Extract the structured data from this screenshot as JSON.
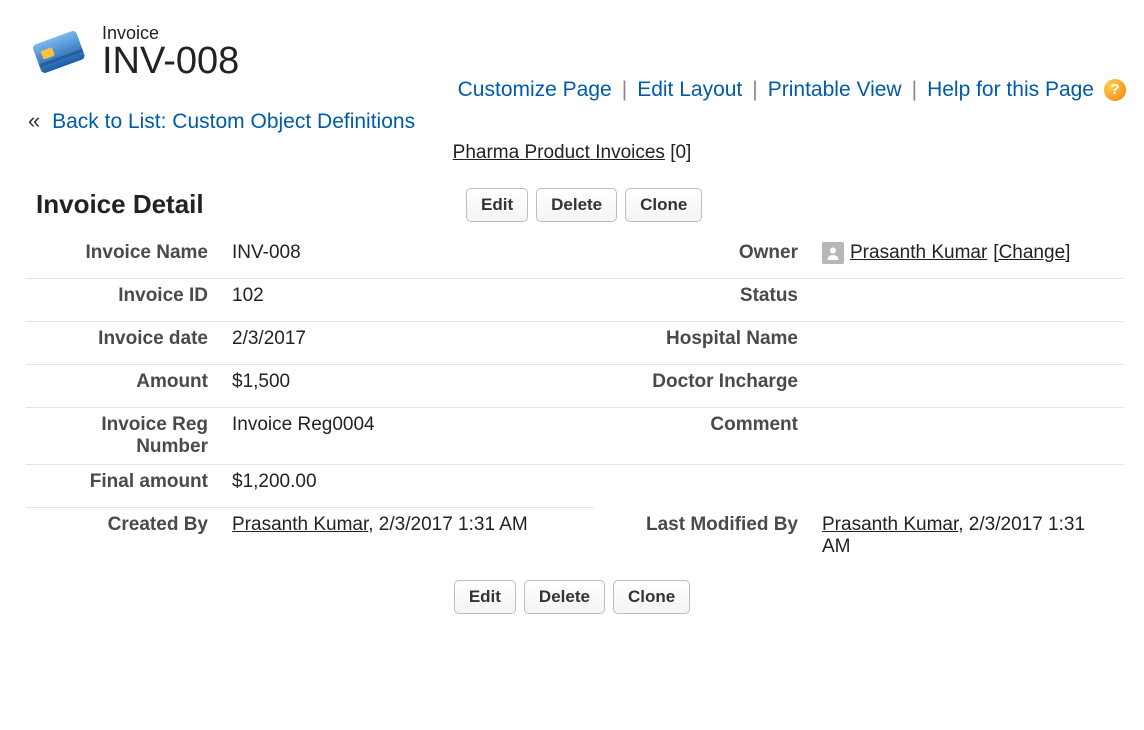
{
  "header": {
    "object_label": "Invoice",
    "record_name": "INV-008"
  },
  "action_links": {
    "customize": "Customize Page",
    "edit_layout": "Edit Layout",
    "printable": "Printable View",
    "help": "Help for this Page"
  },
  "back_link": "Back to List: Custom Object Definitions",
  "related": {
    "label": "Pharma Product Invoices",
    "count_display": "[0]"
  },
  "section_title": "Invoice Detail",
  "buttons": {
    "edit": "Edit",
    "delete": "Delete",
    "clone": "Clone"
  },
  "labels": {
    "invoice_name": "Invoice Name",
    "owner": "Owner",
    "invoice_id": "Invoice ID",
    "status": "Status",
    "invoice_date": "Invoice date",
    "hospital_name": "Hospital Name",
    "amount": "Amount",
    "doctor_incharge": "Doctor Incharge",
    "invoice_reg_number": "Invoice Reg Number",
    "comment": "Comment",
    "final_amount": "Final amount",
    "created_by": "Created By",
    "last_modified_by": "Last Modified By"
  },
  "values": {
    "invoice_name": "INV-008",
    "owner_name": "Prasanth Kumar",
    "owner_change": "[Change]",
    "invoice_id": "102",
    "status": "",
    "invoice_date": "2/3/2017",
    "hospital_name": "",
    "amount": "$1,500",
    "doctor_incharge": "",
    "invoice_reg_number": "Invoice Reg0004",
    "comment": "",
    "final_amount": "$1,200.00",
    "created_by_name": "Prasanth Kumar",
    "created_by_suffix": ", 2/3/2017 1:31 AM",
    "last_modified_by_name": "Prasanth Kumar",
    "last_modified_by_suffix": ", 2/3/2017 1:31 AM"
  }
}
